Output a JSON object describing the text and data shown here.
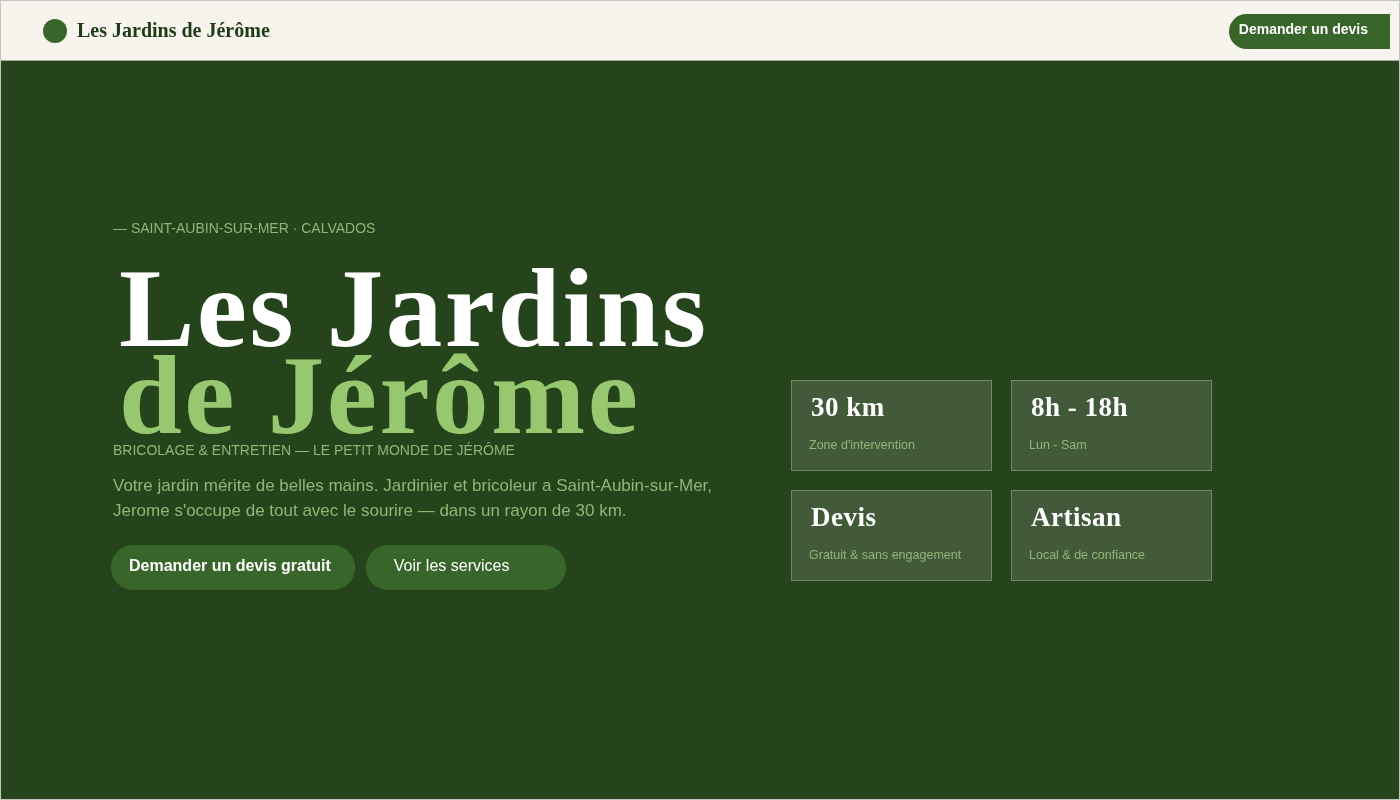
{
  "header": {
    "brand": "Les Jardins de Jérôme",
    "cta": "Demander un devis"
  },
  "hero": {
    "eyebrow": "— SAINT-AUBIN-SUR-MER · CALVADOS",
    "title_line_1": "Les Jardins",
    "title_line_2": "de Jérôme",
    "tagline": "BRICOLAGE & ENTRETIEN — LE PETIT MONDE DE JÉRÔME",
    "description": "Votre jardin mérite de belles mains. Jardinier et bricoleur a Saint-Aubin-sur-Mer, Jerome s'occupe de tout avec le sourire — dans un rayon de 30 km.",
    "buttons": [
      {
        "label": "Demander un devis gratuit",
        "kind": "primary"
      },
      {
        "label": "Voir les services",
        "kind": "secondary"
      }
    ]
  },
  "highlights": [
    {
      "value": "30 km",
      "label": "Zone d'intervention"
    },
    {
      "value": "8h - 18h",
      "label": "Lun - Sam"
    },
    {
      "value": "Devis",
      "label": "Gratuit & sans engagement"
    },
    {
      "value": "Artisan",
      "label": "Local & de confiance"
    }
  ]
}
